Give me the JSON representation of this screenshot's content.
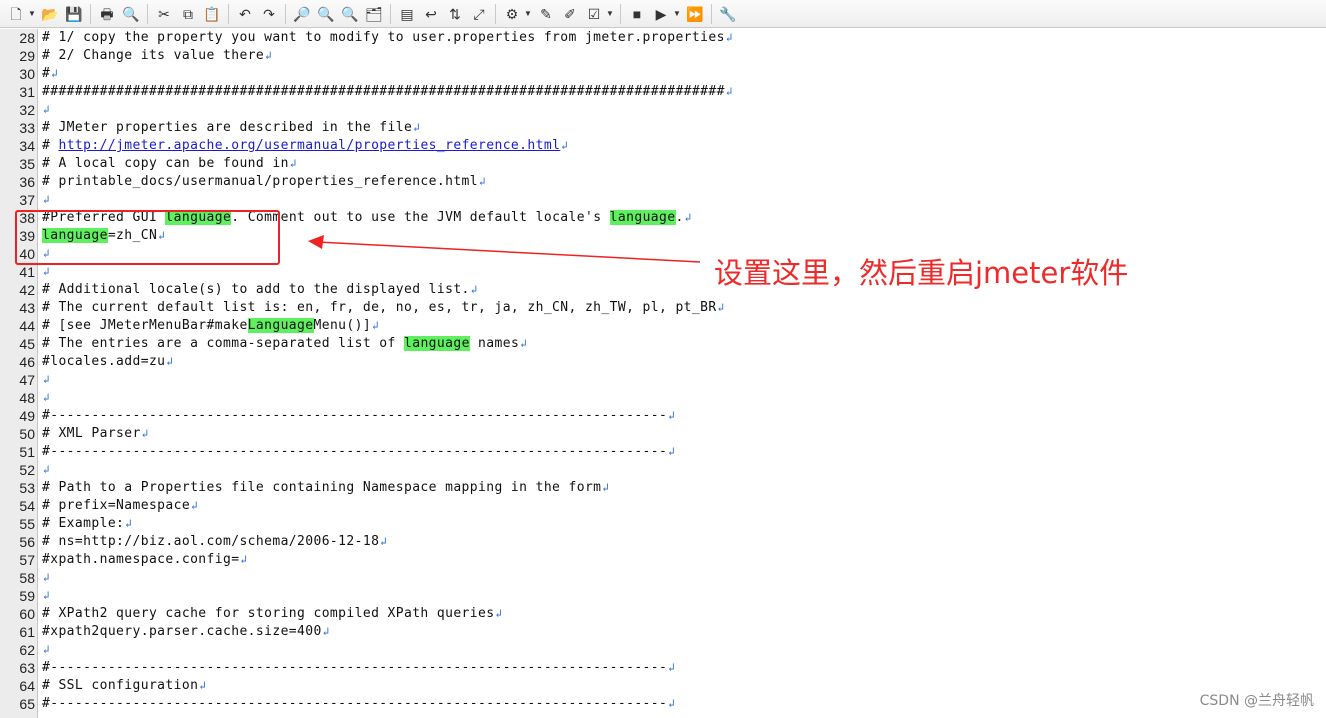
{
  "toolbar": {
    "buttons": [
      {
        "name": "new-file-icon",
        "glyph": "🗋"
      },
      {
        "name": "open-file-icon",
        "glyph": "📂"
      },
      {
        "name": "save-icon",
        "glyph": "💾"
      },
      {
        "name": "print-icon",
        "glyph": "🖶"
      },
      {
        "name": "print-preview-icon",
        "glyph": "🔍"
      },
      {
        "name": "cut-icon",
        "glyph": "✂"
      },
      {
        "name": "copy-icon",
        "glyph": "⧉"
      },
      {
        "name": "paste-icon",
        "glyph": "📋"
      },
      {
        "name": "undo-icon",
        "glyph": "↶"
      },
      {
        "name": "redo-icon",
        "glyph": "↷"
      },
      {
        "name": "find-icon",
        "glyph": "🔎"
      },
      {
        "name": "find-next-icon",
        "glyph": "🔍"
      },
      {
        "name": "find-previous-icon",
        "glyph": "🔍"
      },
      {
        "name": "find-in-files-icon",
        "glyph": "🗂"
      },
      {
        "name": "view-icon",
        "glyph": "▤"
      },
      {
        "name": "word-wrap-icon",
        "glyph": "↩"
      },
      {
        "name": "sync-scroll-icon",
        "glyph": "⇅"
      },
      {
        "name": "fullscreen-icon",
        "glyph": "⤢"
      },
      {
        "name": "encoding-icon",
        "glyph": "⚙"
      },
      {
        "name": "settings-icon",
        "glyph": "✎"
      },
      {
        "name": "tools-icon",
        "glyph": "✐"
      },
      {
        "name": "checklist-icon",
        "glyph": "☑"
      },
      {
        "name": "stop-record-icon",
        "glyph": "■"
      },
      {
        "name": "play-macro-icon",
        "glyph": "▶"
      },
      {
        "name": "macro-run-icon",
        "glyph": "⏩"
      },
      {
        "name": "spell-check-icon",
        "glyph": "🔧"
      }
    ]
  },
  "editor": {
    "lines": [
      {
        "num": "28",
        "segments": [
          {
            "t": "# 1/ copy the property you want to modify to user.properties from jmeter.properties"
          }
        ]
      },
      {
        "num": "29",
        "segments": [
          {
            "t": "# 2/ Change its value there"
          }
        ]
      },
      {
        "num": "30",
        "segments": [
          {
            "t": "#"
          }
        ]
      },
      {
        "num": "31",
        "segments": [
          {
            "t": "###################################################################################"
          }
        ]
      },
      {
        "num": "32",
        "segments": []
      },
      {
        "num": "33",
        "segments": [
          {
            "t": "# JMeter properties are described in the file"
          }
        ]
      },
      {
        "num": "34",
        "segments": [
          {
            "t": "# "
          },
          {
            "t": "http://jmeter.apache.org/usermanual/properties_reference.html",
            "link": true
          }
        ]
      },
      {
        "num": "35",
        "segments": [
          {
            "t": "# A local copy can be found in"
          }
        ]
      },
      {
        "num": "36",
        "segments": [
          {
            "t": "# printable_docs/usermanual/properties_reference.html"
          }
        ]
      },
      {
        "num": "37",
        "segments": []
      },
      {
        "num": "38",
        "segments": [
          {
            "t": "#Preferred GUI "
          },
          {
            "t": "language",
            "hl": true
          },
          {
            "t": ". Comment out to use the JVM default locale's "
          },
          {
            "t": "language",
            "hl": true
          },
          {
            "t": "."
          }
        ]
      },
      {
        "num": "39",
        "segments": [
          {
            "t": "language",
            "hl": true
          },
          {
            "t": "=zh_CN"
          }
        ]
      },
      {
        "num": "40",
        "segments": []
      },
      {
        "num": "41",
        "segments": []
      },
      {
        "num": "42",
        "segments": [
          {
            "t": "# Additional locale(s) to add to the displayed list."
          }
        ]
      },
      {
        "num": "43",
        "segments": [
          {
            "t": "# The current default list is: en, fr, de, no, es, tr, ja, zh_CN, zh_TW, pl, pt_BR"
          }
        ]
      },
      {
        "num": "44",
        "segments": [
          {
            "t": "# [see JMeterMenuBar#make"
          },
          {
            "t": "Language",
            "hl": true
          },
          {
            "t": "Menu()]"
          }
        ]
      },
      {
        "num": "45",
        "segments": [
          {
            "t": "# The entries are a comma-separated list of "
          },
          {
            "t": "language",
            "hl": true
          },
          {
            "t": " names"
          }
        ]
      },
      {
        "num": "46",
        "segments": [
          {
            "t": "#locales.add=zu"
          }
        ]
      },
      {
        "num": "47",
        "segments": []
      },
      {
        "num": "48",
        "segments": []
      },
      {
        "num": "49",
        "segments": [
          {
            "t": "#---------------------------------------------------------------------------"
          }
        ]
      },
      {
        "num": "50",
        "segments": [
          {
            "t": "# XML Parser"
          }
        ]
      },
      {
        "num": "51",
        "segments": [
          {
            "t": "#---------------------------------------------------------------------------"
          }
        ]
      },
      {
        "num": "52",
        "segments": []
      },
      {
        "num": "53",
        "segments": [
          {
            "t": "# Path to a Properties file containing Namespace mapping in the form"
          }
        ]
      },
      {
        "num": "54",
        "segments": [
          {
            "t": "# prefix=Namespace"
          }
        ]
      },
      {
        "num": "55",
        "segments": [
          {
            "t": "# Example:"
          }
        ]
      },
      {
        "num": "56",
        "segments": [
          {
            "t": "# ns=http://biz.aol.com/schema/2006-12-18"
          }
        ]
      },
      {
        "num": "57",
        "segments": [
          {
            "t": "#xpath.namespace.config="
          }
        ]
      },
      {
        "num": "58",
        "segments": []
      },
      {
        "num": "59",
        "segments": []
      },
      {
        "num": "60",
        "segments": [
          {
            "t": "# XPath2 query cache for storing compiled XPath queries"
          }
        ]
      },
      {
        "num": "61",
        "segments": [
          {
            "t": "#xpath2query.parser.cache.size=400"
          }
        ]
      },
      {
        "num": "62",
        "segments": []
      },
      {
        "num": "63",
        "segments": [
          {
            "t": "#---------------------------------------------------------------------------"
          }
        ]
      },
      {
        "num": "64",
        "segments": [
          {
            "t": "# SSL configuration"
          }
        ]
      },
      {
        "num": "65",
        "segments": [
          {
            "t": "#---------------------------------------------------------------------------"
          }
        ]
      }
    ],
    "eol_glyph": "↲"
  },
  "annotation": {
    "text": "设置这里，然后重启jmeter软件",
    "color": "#ee2a2a"
  },
  "watermark": "CSDN @兰舟轻帆"
}
